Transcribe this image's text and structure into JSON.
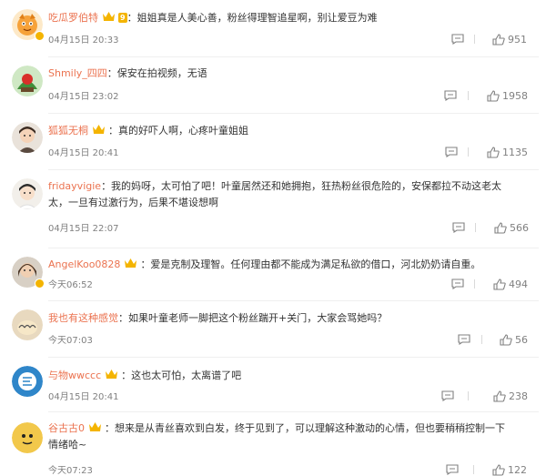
{
  "comments": [
    {
      "user": "吃瓜罗伯特",
      "text": "：姐姐真是人美心善，粉丝得理智追星啊，别让爱豆为难",
      "time": "04月15日 20:33",
      "likes": "951",
      "vip": "crown",
      "level": "9"
    },
    {
      "user": "Shmily_四四",
      "text": "：保安在拍视频，无语",
      "time": "04月15日 23:02",
      "likes": "1958",
      "vip": ""
    },
    {
      "user": "狐狐无桐",
      "text": "：真的好吓人啊，心疼叶童姐姐",
      "time": "04月15日 20:41",
      "likes": "1135",
      "vip": "crown"
    },
    {
      "user": "fridayvigie",
      "text": "：我的妈呀，太可怕了吧！叶童居然还和她拥抱，狂热粉丝很危险的，安保都拉不动这老太",
      "text2": "太，一旦有过激行为，后果不堪设想啊",
      "time": "04月15日 22:07",
      "likes": "566",
      "vip": ""
    },
    {
      "user": "AngelKoo0828",
      "text": "：爱是克制及理智。任何理由都不能成为满足私欲的借口，河北奶奶请自重。",
      "time": "今天06:52",
      "likes": "494",
      "vip": "crown"
    },
    {
      "user": "我也有这种感觉",
      "text": "：如果叶童老师一脚把这个粉丝踹开+关门，大家会骂她吗？",
      "time": "今天07:03",
      "likes": "56",
      "vip": ""
    },
    {
      "user": "与物wwccc",
      "text": "：这也太可怕，太离谱了吧",
      "time": "04月15日 20:41",
      "likes": "238",
      "vip": "crown"
    },
    {
      "user": "谷古古0",
      "text": "：想来是从青丝喜欢到白发，终于见到了，可以理解这种激动的心情，但也要稍稍控制一下",
      "text2": "情绪哈~",
      "time": "今天07:23",
      "likes": "122",
      "vip": "crown"
    }
  ],
  "colors": {
    "username": "#eb7350",
    "text": "#333333",
    "meta": "#808080",
    "vip": "#f4b400"
  }
}
